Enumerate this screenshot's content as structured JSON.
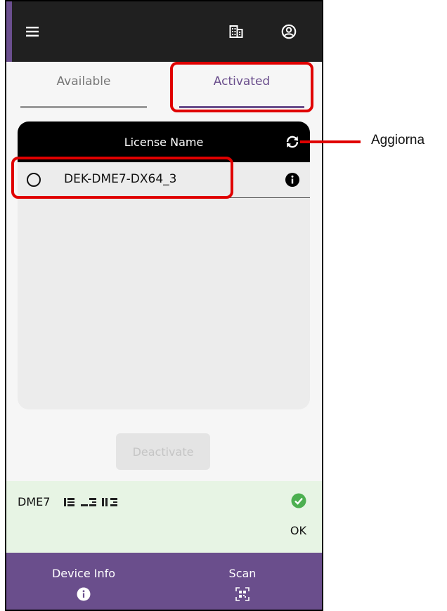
{
  "tabs": [
    {
      "label": "Available"
    },
    {
      "label": "Activated"
    }
  ],
  "table": {
    "header": "License Name",
    "rows": [
      {
        "name": "DEK-DME7-DX64_3"
      }
    ]
  },
  "deactivate_label": "Deactivate",
  "status": {
    "device": "DME7",
    "serial": "",
    "state": "OK"
  },
  "bottom_nav": {
    "device_info_label": "Device Info",
    "scan_label": "Scan"
  },
  "callout": {
    "label": "Aggiorna"
  },
  "colors": {
    "accent": "#6a4e8c",
    "highlight": "#e00000",
    "ok_green": "#4caf50"
  }
}
